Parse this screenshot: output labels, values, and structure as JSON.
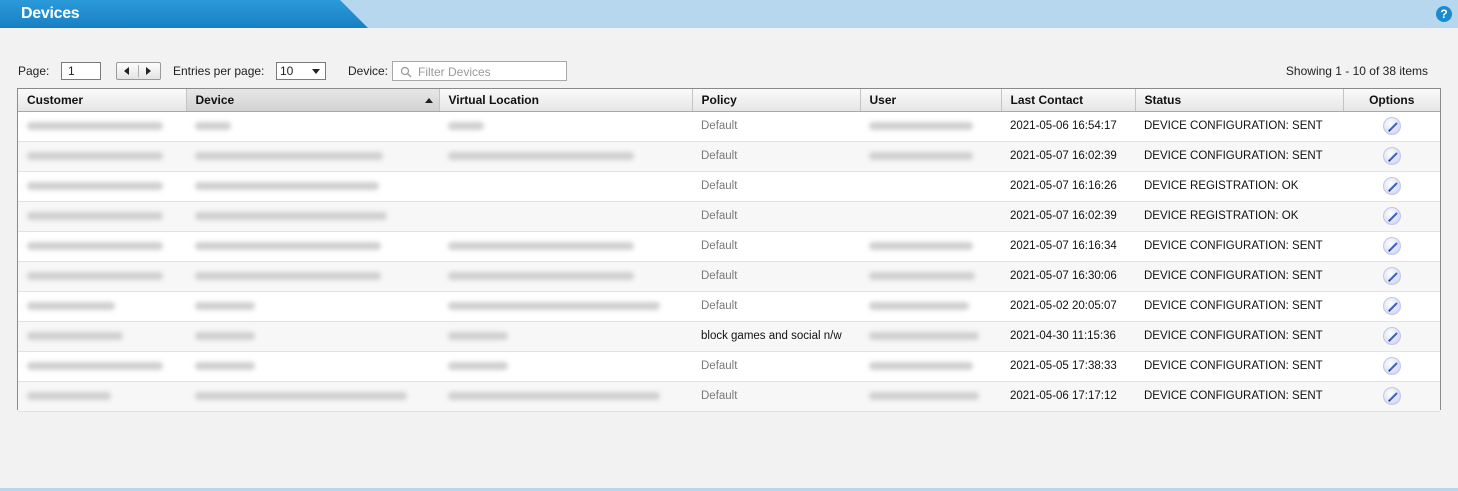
{
  "header": {
    "title": "Devices",
    "help_icon": "help-icon",
    "help_symbol": "?"
  },
  "toolbar": {
    "page_label": "Page:",
    "page_value": "1",
    "entries_label": "Entries per page:",
    "entries_value": "10",
    "device_label": "Device:",
    "filter_placeholder": "Filter Devices",
    "showing": "Showing 1 - 10 of 38 items"
  },
  "columns": {
    "customer": "Customer",
    "device": "Device",
    "virtual_location": "Virtual Location",
    "policy": "Policy",
    "user": "User",
    "last_contact": "Last Contact",
    "status": "Status",
    "options": "Options"
  },
  "rows": [
    {
      "policy": "Default",
      "last_contact": "2021-05-06 16:54:17",
      "status": "DEVICE CONFIGURATION: SENT",
      "customer_redacted": true,
      "device_redacted": true,
      "location_redacted": true,
      "user_redacted": true
    },
    {
      "policy": "Default",
      "last_contact": "2021-05-07 16:02:39",
      "status": "DEVICE CONFIGURATION: SENT",
      "customer_redacted": true,
      "device_redacted": true,
      "location_redacted": true,
      "user_redacted": true
    },
    {
      "policy": "Default",
      "last_contact": "2021-05-07 16:16:26",
      "status": "DEVICE REGISTRATION: OK",
      "customer_redacted": true,
      "device_redacted": true,
      "location_redacted": false,
      "user_redacted": false
    },
    {
      "policy": "Default",
      "last_contact": "2021-05-07 16:02:39",
      "status": "DEVICE REGISTRATION: OK",
      "customer_redacted": true,
      "device_redacted": true,
      "location_redacted": false,
      "user_redacted": false
    },
    {
      "policy": "Default",
      "last_contact": "2021-05-07 16:16:34",
      "status": "DEVICE CONFIGURATION: SENT",
      "customer_redacted": true,
      "device_redacted": true,
      "location_redacted": true,
      "user_redacted": true
    },
    {
      "policy": "Default",
      "last_contact": "2021-05-07 16:30:06",
      "status": "DEVICE CONFIGURATION: SENT",
      "customer_redacted": true,
      "device_redacted": true,
      "location_redacted": true,
      "user_redacted": true
    },
    {
      "policy": "Default",
      "last_contact": "2021-05-02 20:05:07",
      "status": "DEVICE CONFIGURATION: SENT",
      "customer_redacted": true,
      "device_redacted": true,
      "location_redacted": true,
      "user_redacted": true
    },
    {
      "policy": "block games and social n/w",
      "last_contact": "2021-04-30 11:15:36",
      "status": "DEVICE CONFIGURATION: SENT",
      "customer_redacted": true,
      "device_redacted": true,
      "location_redacted": true,
      "user_redacted": true
    },
    {
      "policy": "Default",
      "last_contact": "2021-05-05 17:38:33",
      "status": "DEVICE CONFIGURATION: SENT",
      "customer_redacted": true,
      "device_redacted": true,
      "location_redacted": true,
      "user_redacted": true
    },
    {
      "policy": "Default",
      "last_contact": "2021-05-06 17:17:12",
      "status": "DEVICE CONFIGURATION: SENT",
      "customer_redacted": true,
      "device_redacted": true,
      "location_redacted": true,
      "user_redacted": true
    }
  ],
  "row_option_icon": "edit-pencil-icon",
  "colors": {
    "header_blue": "#1b8bd0",
    "title_bar": "#b7d7ee",
    "background": "#f2f2f2"
  }
}
